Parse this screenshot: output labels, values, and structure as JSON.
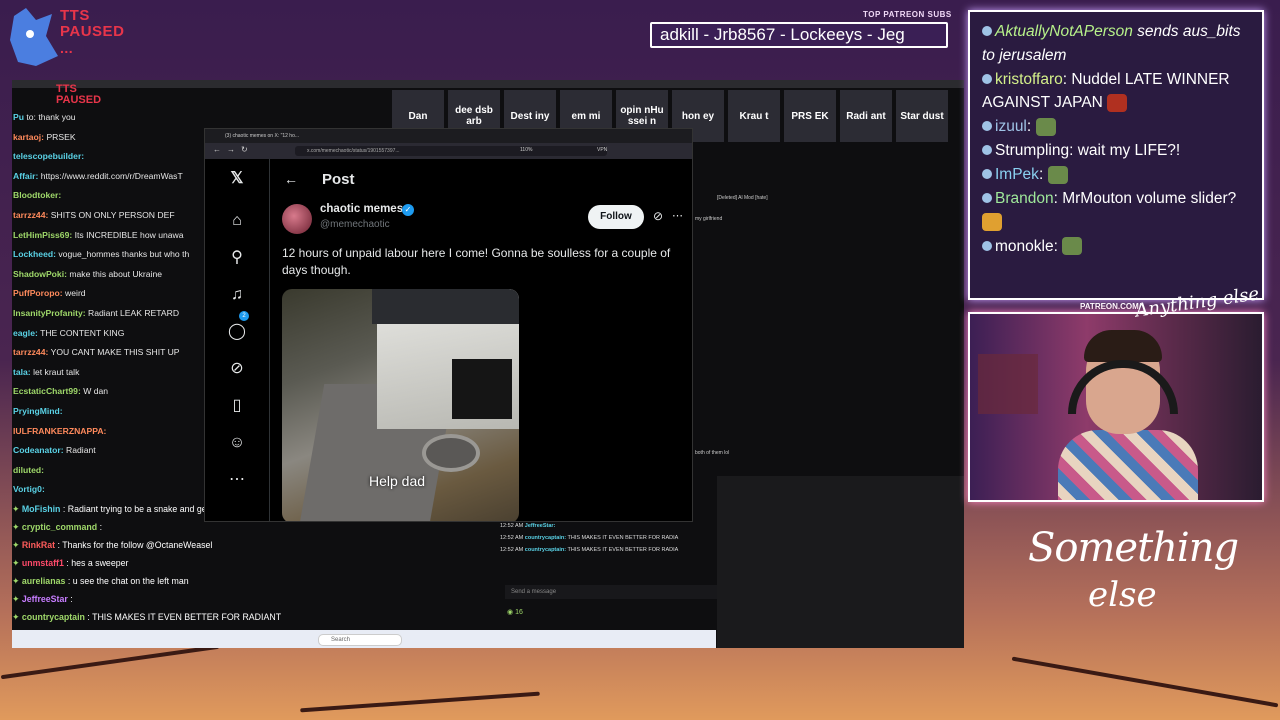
{
  "overlay": {
    "tts_status": "TTS PAUSED",
    "tts_dots": "...",
    "tts_status_small": "TTS PAUSED",
    "patreon_label": "TOP PATREON SUBS",
    "ticker": "adkill - Jrb8567 - Lockeeys - Jeg",
    "patreon_url": "PATREON.COM/",
    "logo_small": "Anything else",
    "signature_line1": "Something",
    "signature_line2": "else"
  },
  "emote_strip": [
    "Dan",
    "dee dsb arb",
    "Dest iny",
    "em mi",
    "opin nHu ssei n",
    "hon ey",
    "Krau t",
    "PRS EK",
    "Radi ant",
    "Star dust"
  ],
  "left_chat": [
    {
      "user": "Pu",
      "text": "to: thank you",
      "cls": "u"
    },
    {
      "user": "kartaoj:",
      "text": "PRSEK",
      "cls": "u3"
    },
    {
      "user": "telescopebuilder:",
      "text": "",
      "cls": "u"
    },
    {
      "user": "Affair:",
      "text": "https://www.reddit.com/r/DreamWasT",
      "cls": "u"
    },
    {
      "user": "Bloodtoker:",
      "text": "",
      "cls": "u2"
    },
    {
      "user": "tarrzz44:",
      "text": "SHITS ON ONLY PERSON DEF",
      "cls": "u3"
    },
    {
      "user": "LetHimPiss69:",
      "text": "Its INCREDIBLE how unawa",
      "cls": "u2"
    },
    {
      "user": "Lockheed:",
      "text": "vogue_hommes thanks but who th",
      "cls": "u"
    },
    {
      "user": "ShadowPoki:",
      "text": "make this about Ukraine",
      "cls": "u2"
    },
    {
      "user": "PuffPoropo:",
      "text": "weird",
      "cls": "u3"
    },
    {
      "user": "InsanityProfanity:",
      "text": "Radiant LEAK RETARD",
      "cls": "u2"
    },
    {
      "user": "eagle:",
      "text": "THE CONTENT KING",
      "cls": "u"
    },
    {
      "user": "tarrzz44:",
      "text": "YOU CANT MAKE THIS SHIT UP",
      "cls": "u3"
    },
    {
      "user": "tala:",
      "text": "let kraut talk",
      "cls": "u"
    },
    {
      "user": "EcstaticChart99:",
      "text": "W dan",
      "cls": "u2"
    },
    {
      "user": "PryingMind:",
      "text": "",
      "cls": "u"
    },
    {
      "user": "IULFRANKERZNAPPA:",
      "text": "",
      "cls": "u3"
    },
    {
      "user": "Codeanator:",
      "text": "Radiant",
      "cls": "u"
    },
    {
      "user": "diluted:",
      "text": "",
      "cls": "u2"
    },
    {
      "user": "Vortig0:",
      "text": "",
      "cls": "u"
    }
  ],
  "bottom_chat": [
    {
      "user": "MoFishin",
      "text": ": Radiant trying to be a snake and get with both of them lol",
      "color": "#5ad2e6"
    },
    {
      "user": "cryptic_command",
      "text": ":",
      "color": "#9fd86a"
    },
    {
      "user": "RinkRat",
      "text": ": Thanks for the follow @OctaneWeasel",
      "color": "#ff5c5c"
    },
    {
      "user": "unmstaff1",
      "text": ": hes a sweeper",
      "color": "#ff4a6a"
    },
    {
      "user": "aurelianas",
      "text": ": u see the chat on the left man",
      "color": "#9fd86a"
    },
    {
      "user": "JeffreeStar",
      "text": ":",
      "color": "#c77dff"
    },
    {
      "user": "countrycaptain",
      "text": ": THIS MAKES IT EVEN BETTER FOR RADIANT",
      "color": "#9fd86a"
    }
  ],
  "right_bg_chat": [
    {
      "time": "12:52 AM",
      "user": "JeffreeStar:",
      "text": ""
    },
    {
      "time": "12:52 AM",
      "user": "countrycaptain:",
      "text": "THIS MAKES IT EVEN BETTER FOR RADIA"
    },
    {
      "time": "12:52 AM",
      "user": "countrycaptain:",
      "text": "THIS MAKES IT EVEN BETTER FOR RADIA"
    }
  ],
  "bg_fragments": {
    "deleted": "[Deleted] Al Mod [hate]",
    "girlfriend": "my girlfriend",
    "both": "both of them lol",
    "send_message": "Send a message",
    "viewers": "16"
  },
  "taskbar": {
    "search_placeholder": "Search"
  },
  "browser": {
    "tab_title": "(3) chaotic memes on X: \"12 ho...",
    "url": "x.com/memechaotic/status/1901557397...",
    "zoom": "110%",
    "vpn": "VPN"
  },
  "x_post": {
    "header": "Post",
    "author_name": "chaotic memes",
    "author_handle": "@memechaotic",
    "follow_label": "Follow",
    "text": "12 hours of unpaid labour here I come! Gonna be soulless for a couple of days though.",
    "media_caption": "Help dad",
    "notification_count": "2"
  },
  "stream_chat": [
    {
      "user": "AktuallyNotAPerson",
      "text": "sends aus_bits to jerusalem",
      "color": "#b7f28a",
      "italic": true
    },
    {
      "user": "kristoffaro",
      "text": "Nuddel LATE WINNER AGAINST JAPAN",
      "color": "#d4f08a",
      "italic": false
    },
    {
      "user": "izuul",
      "text": "",
      "color": "#9fc3e6",
      "italic": false
    },
    {
      "user": "Strumpling",
      "text": "wait my LIFE?!",
      "color": "#ffffff",
      "italic": false
    },
    {
      "user": "ImPek",
      "text": "",
      "color": "#8ad0f0",
      "italic": false
    },
    {
      "user": "Brandon",
      "text": "MrMouton volume slider?",
      "color": "#9fe89a",
      "italic": false
    },
    {
      "user": "monokle",
      "text": "",
      "color": "#ffffff",
      "italic": false
    }
  ],
  "colors": {
    "accent_tts": "#e8354a",
    "x_blue": "#1d9bf0",
    "chat_border": "#ffffff",
    "bg_top": "#3a1d4e",
    "bg_bottom": "#e09a5c"
  }
}
